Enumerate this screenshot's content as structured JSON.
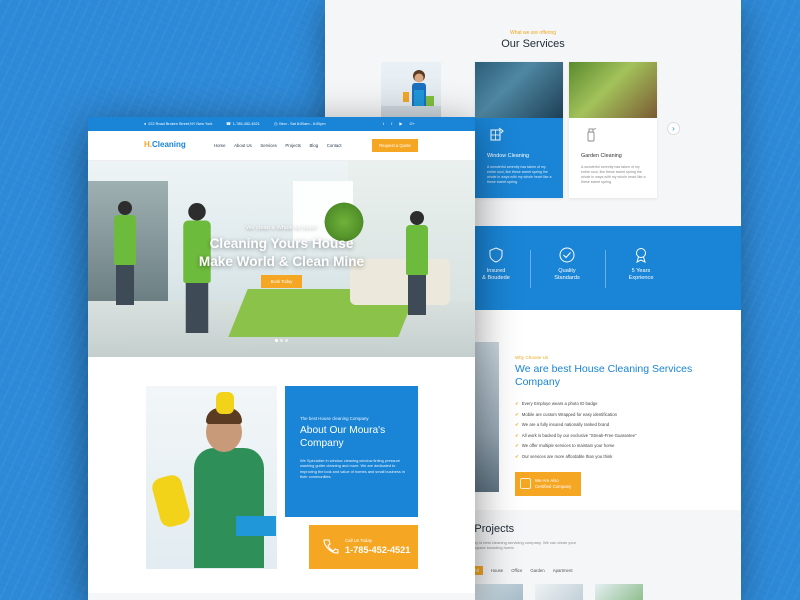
{
  "colors": {
    "brand_blue": "#1a85d6",
    "accent_orange": "#f5a623",
    "background_blue": "#2e8ad8"
  },
  "back_page": {
    "services": {
      "kicker": "What we are offering",
      "title": "Our Services",
      "cards": [
        {
          "title": "Window Cleaning",
          "text": "A wonderful serenity has taken of my entire soul, like these sweet spring the whole in ways with my whole heart like a these sweet spring.",
          "icon": "window-cleaning-icon",
          "active": true
        },
        {
          "title": "Garden Cleaning",
          "text": "A wonderful serenity has taken of my entire soul, like these sweet spring the whole in ways with my whole heart like a these sweet spring.",
          "icon": "spray-bottle-icon",
          "active": false
        }
      ],
      "next_icon": "chevron-right-icon"
    },
    "stats": [
      {
        "line1": "Insured",
        "line2": "& Boudede",
        "icon": "shield-icon"
      },
      {
        "line1": "Quality",
        "line2": "Standards",
        "icon": "badge-check-icon"
      },
      {
        "line1": "5 Years",
        "line2": "Exprience",
        "icon": "trophy-icon"
      }
    ],
    "why": {
      "kicker": "Why Choose Us",
      "title": "We are best House Cleaning Services Company",
      "items": [
        "Every Employe wears a photo ID badge",
        "Mobile are custom Wrapped for easy identification",
        "We are a fully insured nationally ranked brand",
        "All work is backed by our exclusive “Streak-Free Guarantee”",
        "We offer multiple services to maintain your home",
        "Our services are more affordable than you think"
      ],
      "certified_line1": "We Are Also",
      "certified_line2": "Certified Company"
    },
    "projects": {
      "title": "Our Projects",
      "text": "ty is best cleaning servicing company. We can clean your space including home.",
      "filters": [
        "All",
        "House",
        "Office",
        "Garden",
        "Apartment"
      ],
      "active_filter": "All"
    }
  },
  "front_page": {
    "topbar": {
      "address": "222 Road Broken Street,NY New York",
      "phone": "1-785-452-4521",
      "hours": "Mon - Sat 8:00am - 6:00pm",
      "social_icons": [
        "twitter-icon",
        "facebook-icon",
        "youtube-icon",
        "google-plus-icon"
      ]
    },
    "logo": {
      "prefix": "H.",
      "name": "Cleaning"
    },
    "nav": [
      "Home",
      "About Us",
      "Services",
      "Projects",
      "Blog",
      "Contact"
    ],
    "quote_button": "Request a Quote",
    "hero": {
      "kicker": "We clean a Whole lot more!",
      "headline_line1": "Cleaning Yours House",
      "headline_line2": "Make World & Clean Mine",
      "button": "Book Today"
    },
    "about": {
      "kicker": "The best House cleaning Company",
      "title": "About Our Moura's Company",
      "text": "We Specialize in window cleaning,window tinting pressure washing gutter cleaning and more. We are dedicated to improving the look and value of homes and small business in their communities.",
      "call_label": "Call Us Today",
      "call_number": "1-785-452-4521"
    }
  }
}
